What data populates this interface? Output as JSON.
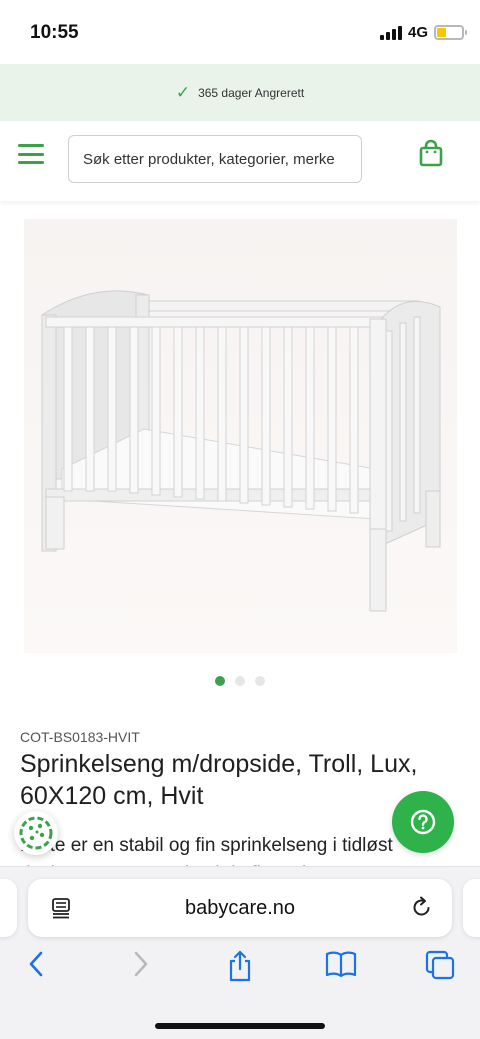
{
  "status_bar": {
    "time": "10:55",
    "network": "4G"
  },
  "promo": {
    "text": "365 dager Angrerett"
  },
  "header": {
    "search_placeholder": "Søk etter produkter, kategorier, merke"
  },
  "gallery": {
    "image_count": 3,
    "active_index": 0
  },
  "product": {
    "sku": "COT-BS0183-HVIT",
    "title": "Sprinkelseng m/dropside, Troll, Lux, 60X120 cm, Hvit",
    "description_line": "Dette er en stabil og fin sprinkelseng i tidløst",
    "description_faded": "design som passer inn i de fleste barnerom"
  },
  "browser": {
    "url": "babycare.no"
  },
  "colors": {
    "accent": "#3aa34a",
    "help_button": "#2fb24a",
    "promo_bg": "#e9f3e9",
    "browser_blue": "#1a73e8"
  },
  "icons": [
    "checkmark-icon",
    "menu-icon",
    "shopping-bag-icon",
    "help-icon",
    "cookie-icon",
    "reader-icon",
    "reload-icon",
    "back-icon",
    "forward-icon",
    "share-icon",
    "bookmarks-icon",
    "tabs-icon"
  ]
}
